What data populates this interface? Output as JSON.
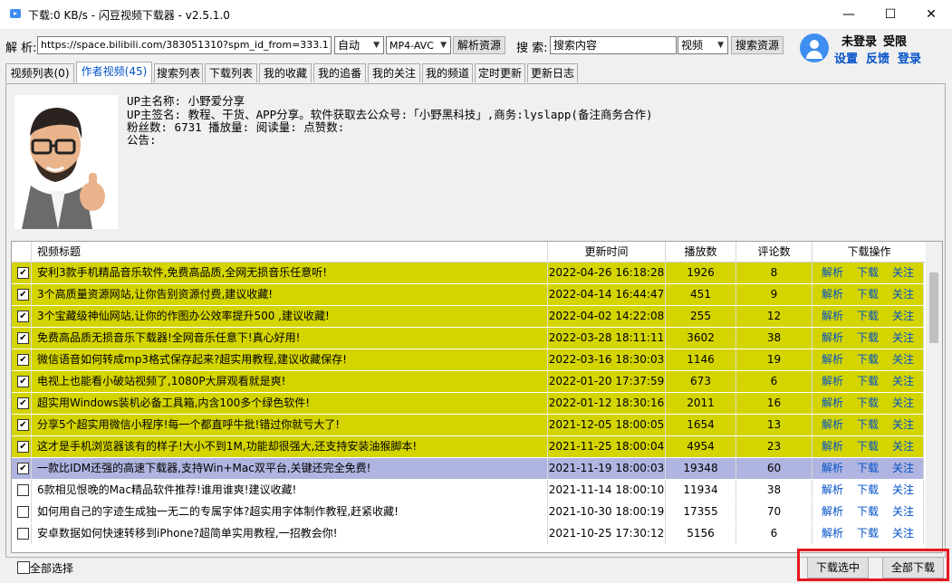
{
  "window": {
    "title": "下载:0 KB/s - 闪豆视频下载器 - v2.5.1.0",
    "minimize": "—",
    "maximize": "☐",
    "close": "✕"
  },
  "parse": {
    "label": "解  析:",
    "url": "https://space.bilibili.com/383051310?spm_id_from=333.1",
    "mode": "自动",
    "format": "MP4-AVC",
    "button": "解析资源"
  },
  "search": {
    "label": "搜  索:",
    "value": "搜索内容",
    "type": "视频",
    "button": "搜索资源"
  },
  "user": {
    "status": "未登录",
    "limit": "受限",
    "settings": "设置",
    "feedback": "反馈",
    "login": "登录"
  },
  "tabs": [
    {
      "label": "视频列表(0)"
    },
    {
      "label": "作者视频(45)"
    },
    {
      "label": "搜索列表"
    },
    {
      "label": "下载列表"
    },
    {
      "label": "我的收藏"
    },
    {
      "label": "我的追番"
    },
    {
      "label": "我的关注"
    },
    {
      "label": "我的频道"
    },
    {
      "label": "定时更新"
    },
    {
      "label": "更新日志"
    }
  ],
  "profile": {
    "name_line": "UP主名称: 小野爱分享",
    "sign_line": "UP主签名: 教程、干货、APP分享。软件获取去公众号:「小野黑科技」,商务:lyslapp(备注商务合作)",
    "stats_line": "粉丝数: 6731  播放量:   阅读量:   点赞数:",
    "notice_line": "公告:"
  },
  "table": {
    "headers": [
      "视频标题",
      "更新时间",
      "播放数",
      "评论数",
      "下载操作"
    ],
    "action_labels": [
      "解析",
      "下载",
      "关注"
    ],
    "colors": {
      "checked": "#d4d400",
      "selected": "#b0b4e0",
      "normal": "#ffffff"
    },
    "rows": [
      {
        "title": "安利3款手机精品音乐软件,免费高品质,全网无损音乐任意听!",
        "time": "2022-04-26 16:18:28",
        "plays": "1926",
        "comments": "8",
        "state": "checked"
      },
      {
        "title": "3个高质量资源网站,让你告别资源付费,建议收藏!",
        "time": "2022-04-14 16:44:47",
        "plays": "451",
        "comments": "9",
        "state": "checked"
      },
      {
        "title": "3个宝藏级神仙网站,让你的作图办公效率提升500 ,建议收藏!",
        "time": "2022-04-02 14:22:08",
        "plays": "255",
        "comments": "12",
        "state": "checked"
      },
      {
        "title": "免费高品质无损音乐下载器!全网音乐任意下!真心好用!",
        "time": "2022-03-28 18:11:11",
        "plays": "3602",
        "comments": "38",
        "state": "checked"
      },
      {
        "title": "微信语音如何转成mp3格式保存起来?超实用教程,建议收藏保存!",
        "time": "2022-03-16 18:30:03",
        "plays": "1146",
        "comments": "19",
        "state": "checked"
      },
      {
        "title": "电视上也能看小破站视频了,1080P大屏观看就是爽!",
        "time": "2022-01-20 17:37:59",
        "plays": "673",
        "comments": "6",
        "state": "checked"
      },
      {
        "title": "超实用Windows装机必备工具箱,内含100多个绿色软件!",
        "time": "2022-01-12 18:30:16",
        "plays": "2011",
        "comments": "16",
        "state": "checked"
      },
      {
        "title": "分享5个超实用微信小程序!每一个都直呼牛批!错过你就亏大了!",
        "time": "2021-12-05 18:00:05",
        "plays": "1654",
        "comments": "13",
        "state": "checked"
      },
      {
        "title": "这才是手机浏览器该有的样子!大小不到1M,功能却很强大,还支持安装油猴脚本!",
        "time": "2021-11-25 18:00:04",
        "plays": "4954",
        "comments": "23",
        "state": "checked"
      },
      {
        "title": "一款比IDM还强的高速下载器,支持Win+Mac双平台,关键还完全免费!",
        "time": "2021-11-19 18:00:03",
        "plays": "19348",
        "comments": "60",
        "state": "selected"
      },
      {
        "title": "6款相见恨晚的Mac精品软件推荐!谁用谁爽!建议收藏!",
        "time": "2021-11-14 18:00:10",
        "plays": "11934",
        "comments": "38",
        "state": "normal"
      },
      {
        "title": "如何用自己的字迹生成独一无二的专属字体?超实用字体制作教程,赶紧收藏!",
        "time": "2021-10-30 18:00:19",
        "plays": "17355",
        "comments": "70",
        "state": "normal"
      },
      {
        "title": "安卓数据如何快速转移到iPhone?超简单实用教程,一招教会你!",
        "time": "2021-10-25 17:30:12",
        "plays": "5156",
        "comments": "6",
        "state": "normal"
      }
    ]
  },
  "footer": {
    "select_all": "全部选择",
    "download_selected": "下载选中",
    "download_all": "全部下载"
  }
}
